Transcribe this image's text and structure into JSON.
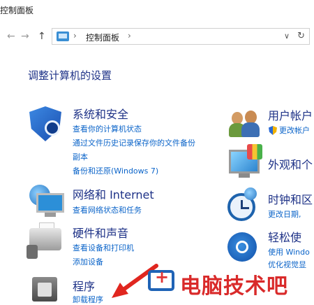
{
  "window": {
    "title": "控制面板"
  },
  "address": {
    "back": "←",
    "forward": "→",
    "up": "↑",
    "sep1": "›",
    "path": "控制面板",
    "sep2": "›",
    "dropdown": "∨",
    "refresh": "↻"
  },
  "page": {
    "heading": "调整计算机的设置"
  },
  "categories": [
    {
      "title": "系统和安全",
      "links": [
        "查看你的计算机状态",
        "通过文件历史记录保存你的文件备份",
        "副本",
        "备份和还原(Windows 7)"
      ],
      "icon": "security-shield-icon"
    },
    {
      "title": "网络和 Internet",
      "links": [
        "查看网络状态和任务"
      ],
      "icon": "network-icon"
    },
    {
      "title": "硬件和声音",
      "links": [
        "查看设备和打印机",
        "添加设备"
      ],
      "icon": "printer-icon"
    },
    {
      "title": "程序",
      "links": [
        "卸载程序"
      ],
      "icon": "programs-icon"
    },
    {
      "title": "用户帐户",
      "links": [
        "更改帐户"
      ],
      "icon": "users-icon"
    },
    {
      "title": "外观和个",
      "links": [],
      "icon": "appearance-icon"
    },
    {
      "title": "时钟和区",
      "links": [
        "更改日期,"
      ],
      "icon": "clock-icon"
    },
    {
      "title": "轻松使",
      "links": [
        "使用 Windo",
        "优化视觉显"
      ],
      "icon": "ease-of-access-icon"
    }
  ],
  "watermark": {
    "text": "电脑技术吧"
  },
  "colors": {
    "heading": "#1e3287",
    "link": "#0b64c9",
    "watermark": "#d92a2a",
    "arrow": "#e0261f"
  }
}
